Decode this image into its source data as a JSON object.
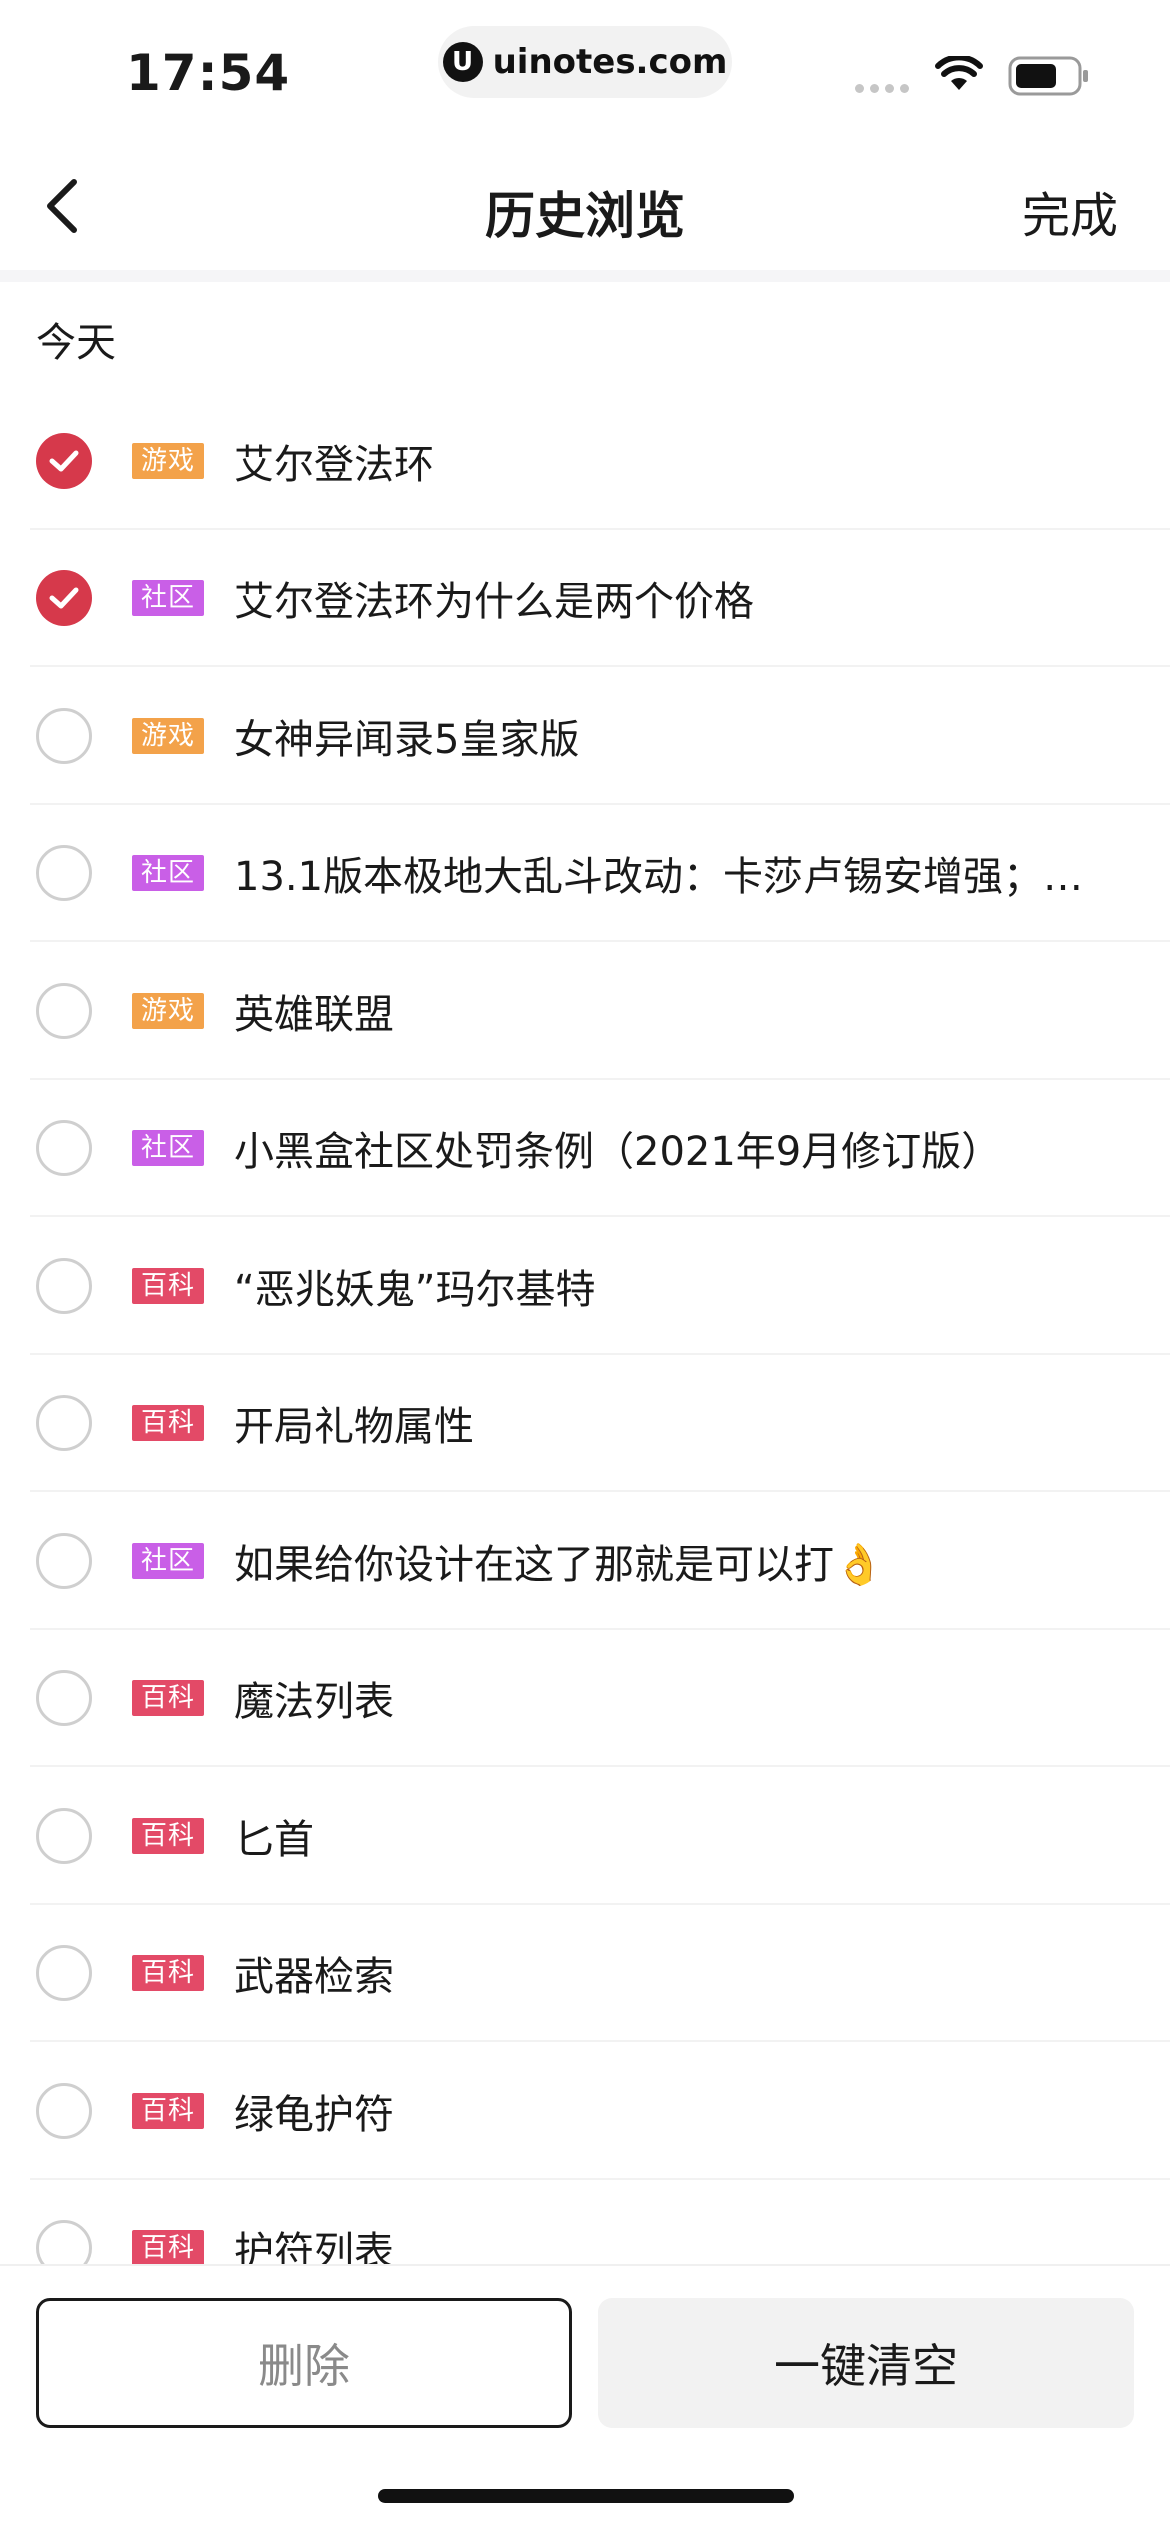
{
  "status_bar": {
    "time": "17:54",
    "url": "uinotes.com"
  },
  "header": {
    "title": "历史浏览",
    "done_label": "完成"
  },
  "section": {
    "label": "今天"
  },
  "tags": {
    "game": "游戏",
    "community": "社区",
    "wiki": "百科"
  },
  "items": [
    {
      "tag": "游戏",
      "type": "game",
      "title": "艾尔登法环",
      "checked": true
    },
    {
      "tag": "社区",
      "type": "community",
      "title": "艾尔登法环为什么是两个价格",
      "checked": true
    },
    {
      "tag": "游戏",
      "type": "game",
      "title": "女神异闻录5皇家版",
      "checked": false
    },
    {
      "tag": "社区",
      "type": "community",
      "title": "13.1版本极地大乱斗改动：卡莎卢锡安增强；…",
      "checked": false
    },
    {
      "tag": "游戏",
      "type": "game",
      "title": "英雄联盟",
      "checked": false
    },
    {
      "tag": "社区",
      "type": "community",
      "title": "小黑盒社区处罚条例（2021年9月修订版）",
      "checked": false
    },
    {
      "tag": "百科",
      "type": "wiki",
      "title": "“恶兆妖鬼”玛尔基特",
      "checked": false
    },
    {
      "tag": "百科",
      "type": "wiki",
      "title": "开局礼物属性",
      "checked": false
    },
    {
      "tag": "社区",
      "type": "community",
      "title": "如果给你设计在这了那就是可以打👌",
      "checked": false
    },
    {
      "tag": "百科",
      "type": "wiki",
      "title": "魔法列表",
      "checked": false
    },
    {
      "tag": "百科",
      "type": "wiki",
      "title": "匕首",
      "checked": false
    },
    {
      "tag": "百科",
      "type": "wiki",
      "title": "武器检索",
      "checked": false
    },
    {
      "tag": "百科",
      "type": "wiki",
      "title": "绿龟护符",
      "checked": false
    },
    {
      "tag": "百科",
      "type": "wiki",
      "title": "护符列表",
      "checked": false
    }
  ],
  "footer": {
    "delete_label": "删除",
    "clear_label": "一键清空"
  },
  "colors": {
    "accent_red": "#d6394b",
    "tag_game": "#f3a24a",
    "tag_community": "#c95fe7",
    "tag_wiki": "#e34a67"
  }
}
